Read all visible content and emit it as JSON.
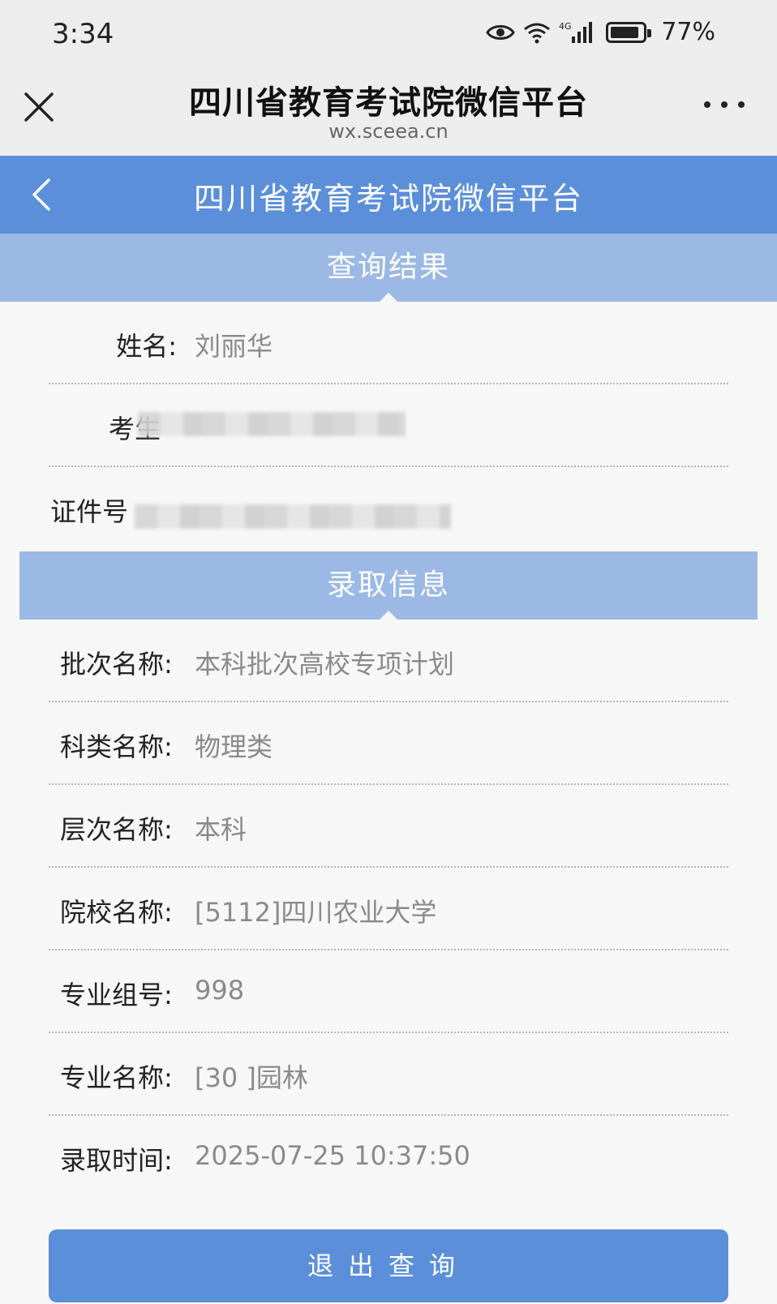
{
  "status_bar": {
    "time": "3:34",
    "network": "4G",
    "battery_percent": "77%",
    "icons": [
      "eye-icon",
      "wifi-icon",
      "signal-icon",
      "battery-icon"
    ]
  },
  "browser": {
    "title": "四川省教育考试院微信平台",
    "url": "wx.sceea.cn"
  },
  "app_header": {
    "title": "四川省教育考试院微信平台"
  },
  "query_result": {
    "heading": "查询结果",
    "name_label": "姓名:",
    "name_value": "刘丽华",
    "exam_no_label": "考生",
    "id_no_label": "证件号"
  },
  "admission": {
    "heading": "录取信息",
    "rows": [
      {
        "label": "批次名称:",
        "value": "本科批次高校专项计划"
      },
      {
        "label": "科类名称:",
        "value": "物理类"
      },
      {
        "label": "层次名称:",
        "value": "本科"
      },
      {
        "label": "院校名称:",
        "value": "[5112]四川农业大学"
      },
      {
        "label": "专业组号:",
        "value": "998"
      },
      {
        "label": "专业名称:",
        "value": "[30 ]园林"
      },
      {
        "label": "录取时间:",
        "value": "2025-07-25 10:37:50"
      }
    ]
  },
  "exit_button_label": "退出查询",
  "colors": {
    "header_blue": "#5b8fd9",
    "section_blue": "#9bb9e4"
  }
}
